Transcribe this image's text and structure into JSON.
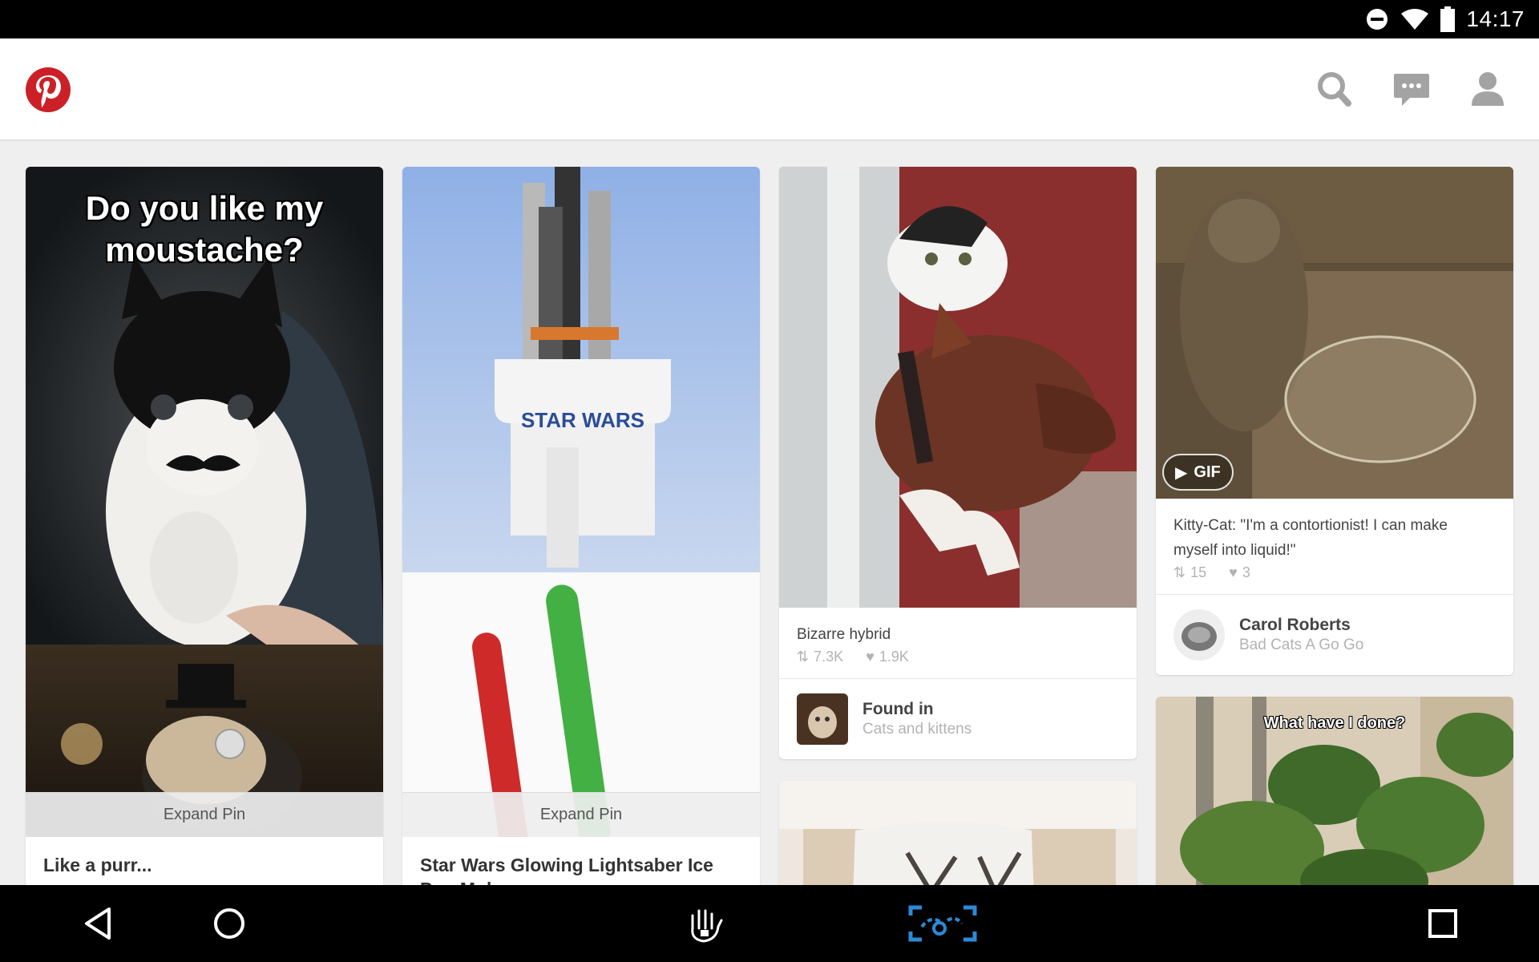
{
  "status_bar": {
    "time": "14:17",
    "icons": [
      "do-not-disturb-icon",
      "wifi-icon",
      "battery-icon"
    ]
  },
  "app_header": {
    "logo": "pinterest-logo",
    "actions": [
      "search-icon",
      "messages-icon",
      "profile-icon"
    ]
  },
  "colors": {
    "brand": "#cb2027",
    "text_dark": "#333333",
    "text_muted": "#b3b3b3",
    "nav_accent": "#2b8ad6"
  },
  "pins": {
    "col1": {
      "meme_text": "Do you like my moustache?",
      "expand_label": "Expand Pin",
      "title": "Like a purr..."
    },
    "col2": {
      "brand_text": "STAR WARS",
      "expand_label": "Expand Pin",
      "title": "Star Wars Glowing Lightsaber Ice Pop Mol"
    },
    "col3a": {
      "description": "Bizarre hybrid",
      "repins": "7.3K",
      "likes": "1.9K",
      "found_in_label": "Found in",
      "board": "Cats and kittens"
    },
    "col4a": {
      "gif_label": "GIF",
      "description": "Kitty-Cat:  \"I'm a contortionist!  I can make myself into liquid!\"",
      "repins": "15",
      "likes": "3",
      "pinner_name": "Carol Roberts",
      "board": "Bad Cats A Go Go"
    },
    "col4b": {
      "meme_text": "What have I done?"
    }
  },
  "nav_bar": {
    "buttons": [
      "back-icon",
      "home-icon",
      "accessibility-icon",
      "screen-capture-icon",
      "recents-icon"
    ]
  }
}
